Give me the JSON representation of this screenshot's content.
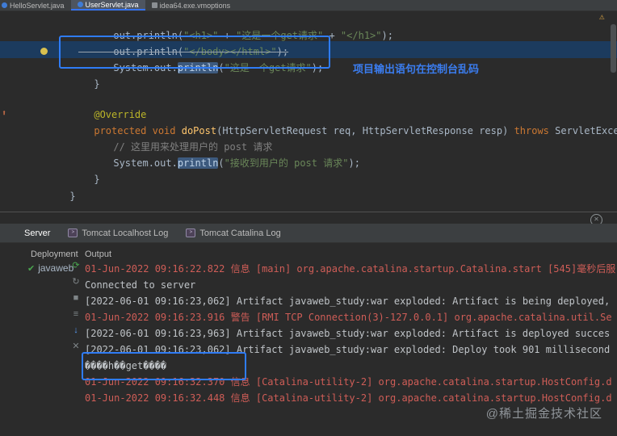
{
  "window": {
    "tabs": [
      {
        "label": "HelloServlet.java"
      },
      {
        "label": "UserServlet.java"
      },
      {
        "label": "idea64.exe.vmoptions"
      }
    ]
  },
  "editor": {
    "annotation_note": "项目输出语句在控制台乱码",
    "l1": {
      "a": "out.println(",
      "b": "\"<h1>\"",
      "c": " + ",
      "d": "\"这是一个get请求\"",
      "e": " + ",
      "f": "\"</h1>\"",
      "g": ");"
    },
    "l2": {
      "a": "out.println(",
      "b": "\"</body></html>\"",
      "c": ");"
    },
    "l3": {
      "a": "System.out.",
      "b": "println",
      "c": "(",
      "d": "\"这是一个get请求\"",
      "e": ");"
    },
    "l4": "}",
    "l5": "@Override",
    "l6": {
      "a": "protected void ",
      "b": "doPost",
      "c": "(HttpServletRequest req, HttpServletResponse resp) ",
      "d": "throws",
      "e": " ServletException,"
    },
    "l7": "// 这里用来处理用户的 post 请求",
    "l8": {
      "a": "System.out.",
      "b": "println",
      "c": "(",
      "d": "\"接收到用户的 post 请求\"",
      "e": ");"
    },
    "l9": "}",
    "l10": "}"
  },
  "console": {
    "tabs": {
      "server": "Server",
      "localhost": "Tomcat Localhost Log",
      "catalina": "Tomcat Catalina Log"
    },
    "deployment_label": "Deployment",
    "deployment_item": "javaweb",
    "output_label": "Output",
    "logs": [
      {
        "text": "01-Jun-2022 09:16:22.822 信息 [main] org.apache.catalina.startup.Catalina.start [545]毫秒后服",
        "type": "error"
      },
      {
        "text": "Connected to server",
        "type": "normal"
      },
      {
        "text": "[2022-06-01 09:16:23,062] Artifact javaweb_study:war exploded: Artifact is being deployed, ",
        "type": "normal"
      },
      {
        "text": "01-Jun-2022 09:16:23.916 警告 [RMI TCP Connection(3)-127.0.0.1] org.apache.catalina.util.Se",
        "type": "error"
      },
      {
        "text": "[2022-06-01 09:16:23,963] Artifact javaweb_study:war exploded: Artifact is deployed succes",
        "type": "normal"
      },
      {
        "text": "[2022-06-01 09:16:23,062] Artifact javaweb_study:war exploded: Deploy took 901 millisecond",
        "type": "normal"
      },
      {
        "text": "����h��get����",
        "type": "normal"
      },
      {
        "text": "01-Jun-2022 09:16:32.370 信息 [Catalina-utility-2] org.apache.catalina.startup.HostConfig.d",
        "type": "error"
      },
      {
        "text": "01-Jun-2022 09:16:32.448 信息 [Catalina-utility-2] org.apache.catalina.startup.HostConfig.d",
        "type": "error"
      }
    ]
  },
  "watermark": "@稀土掘金技术社区"
}
